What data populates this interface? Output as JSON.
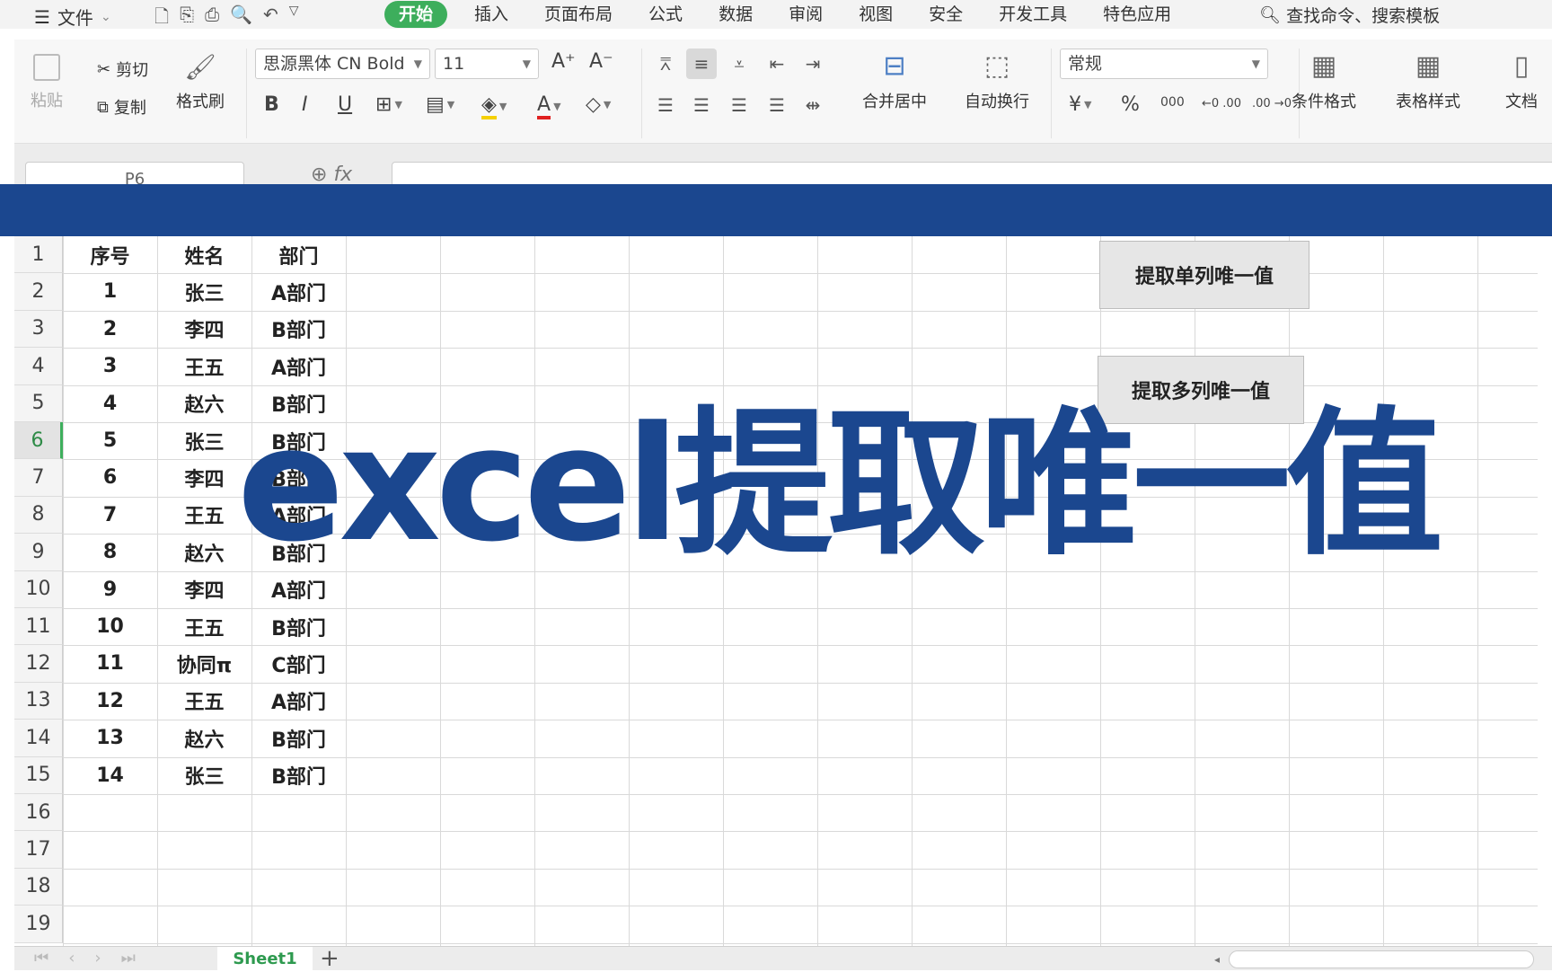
{
  "menu": {
    "file_label": "文件",
    "tabs": [
      "开始",
      "插入",
      "页面布局",
      "公式",
      "数据",
      "审阅",
      "视图",
      "安全",
      "开发工具",
      "特色应用"
    ],
    "search_label": "查找命令、搜索模板"
  },
  "ribbon": {
    "paste": "粘贴",
    "cut": "剪切",
    "copy": "复制",
    "format_painter": "格式刷",
    "font_name": "思源黑体 CN Bold",
    "font_size": "11",
    "bold": "B",
    "italic": "I",
    "underline": "U",
    "merge_center": "合并居中",
    "wrap_text": "自动换行",
    "number_format": "常规",
    "percent": "%",
    "thousands": "000",
    "dec_inc": "←0 .00",
    "dec_dec": ".00 →0",
    "conditional_format": "条件格式",
    "table_style": "表格样式",
    "doc_helper": "文档"
  },
  "formula_bar": {
    "name_box": "P6",
    "fx": "fx"
  },
  "sheet": {
    "row_numbers": [
      "1",
      "2",
      "3",
      "4",
      "5",
      "6",
      "7",
      "8",
      "9",
      "10",
      "11",
      "12",
      "13",
      "14",
      "15",
      "16",
      "17",
      "18",
      "19"
    ],
    "selected_row": "6",
    "headers": [
      "序号",
      "姓名",
      "部门"
    ],
    "rows": [
      [
        "1",
        "张三",
        "A部门"
      ],
      [
        "2",
        "李四",
        "B部门"
      ],
      [
        "3",
        "王五",
        "A部门"
      ],
      [
        "4",
        "赵六",
        "B部门"
      ],
      [
        "5",
        "张三",
        "B部门"
      ],
      [
        "6",
        "李四",
        "B部门"
      ],
      [
        "7",
        "王五",
        "A部门"
      ],
      [
        "8",
        "赵六",
        "B部门"
      ],
      [
        "9",
        "李四",
        "A部门"
      ],
      [
        "10",
        "王五",
        "B部门"
      ],
      [
        "11",
        "协同π",
        "C部门"
      ],
      [
        "12",
        "王五",
        "A部门"
      ],
      [
        "13",
        "赵六",
        "B部门"
      ],
      [
        "14",
        "张三",
        "B部门"
      ]
    ]
  },
  "buttons": {
    "single_col": "提取单列唯一值",
    "multi_col": "提取多列唯一值"
  },
  "overlay": {
    "title": "excel提取唯一值"
  },
  "sheet_tabs": {
    "active": "Sheet1",
    "add": "+"
  },
  "colors": {
    "accent_green": "#3dae5c",
    "banner_blue": "#1b478f"
  }
}
